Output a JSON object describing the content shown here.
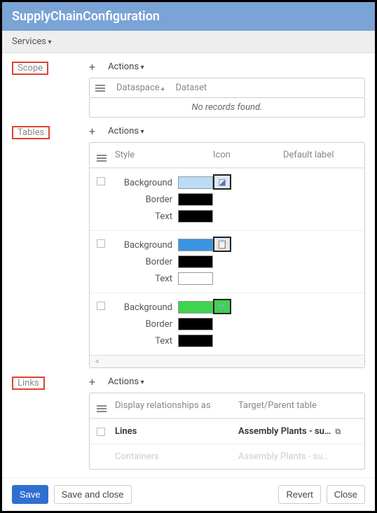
{
  "header": {
    "title": "SupplyChainConfiguration"
  },
  "menubar": {
    "services_label": "Services"
  },
  "sections": {
    "scope": {
      "label": "Scope",
      "add_icon": "+",
      "actions_label": "Actions",
      "col_dataspace": "Dataspace",
      "col_dataset": "Dataset",
      "empty_text": "No records found."
    },
    "tables": {
      "label": "Tables",
      "add_icon": "+",
      "actions_label": "Actions",
      "col_style": "Style",
      "col_icon": "Icon",
      "col_default": "Default label",
      "style_bg": "Background",
      "style_border": "Border",
      "style_text": "Text",
      "rows": [
        {
          "bg": "#bcdcf5",
          "border": "#000000",
          "text": "#000000",
          "icon_bg": "#dfe9f5",
          "icon_color": "#5874a6",
          "icon_name": "bookmark-icon",
          "glyph": "◪"
        },
        {
          "bg": "#3b94e3",
          "border": "#000000",
          "text": "#ffffff",
          "icon_bg": "#dfe9f5",
          "icon_color": "#5874a6",
          "icon_name": "clipboard-icon",
          "glyph": "📋"
        },
        {
          "bg": "#3fd34f",
          "border": "#000000",
          "text": "#000000",
          "icon_bg": "#3fd34f",
          "icon_color": "#000000",
          "icon_name": "cart-icon",
          "glyph": "🛒"
        }
      ],
      "scroll_hint": "<"
    },
    "links": {
      "label": "Links",
      "add_icon": "+",
      "actions_label": "Actions",
      "col_display": "Display relationships as",
      "col_target": "Target/Parent table",
      "rows": [
        {
          "display": "Lines",
          "target": "Assembly Plants - su…",
          "ghost": false
        },
        {
          "display": "Containers",
          "target": "Assembly Plants - su…",
          "ghost": true
        }
      ]
    }
  },
  "footer": {
    "save": "Save",
    "save_close": "Save and close",
    "revert": "Revert",
    "close": "Close"
  }
}
